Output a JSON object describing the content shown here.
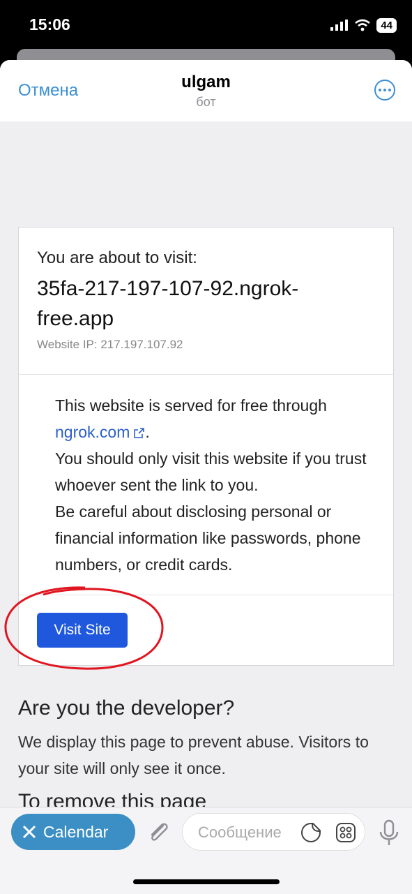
{
  "status": {
    "time": "15:06",
    "battery": "44"
  },
  "header": {
    "cancel": "Отмена",
    "title": "ulgam",
    "subtitle": "бот"
  },
  "notice": {
    "about": "You are about to visit:",
    "host": "35fa-217-197-107-92.ngrok-free.app",
    "ip": "Website IP: 217.197.107.92",
    "line1": "This website is served for free through",
    "link": "ngrok.com",
    "period": ".",
    "line2": "You should only visit this website if you trust whoever sent the link to you.",
    "line3": "Be careful about disclosing personal or financial information like passwords, phone numbers, or credit cards.",
    "button": "Visit Site"
  },
  "developer": {
    "title": "Are you the developer?",
    "text": "We display this page to prevent abuse. Visitors to your site will only see it once.",
    "cut_heading": "To remove this page"
  },
  "bottom": {
    "calendar": "Calendar",
    "placeholder": "Сообщение"
  },
  "colors": {
    "telegram_blue": "#3b8fd4",
    "ngrok_button": "#1f58dd",
    "annotation_red": "#e0151f"
  }
}
